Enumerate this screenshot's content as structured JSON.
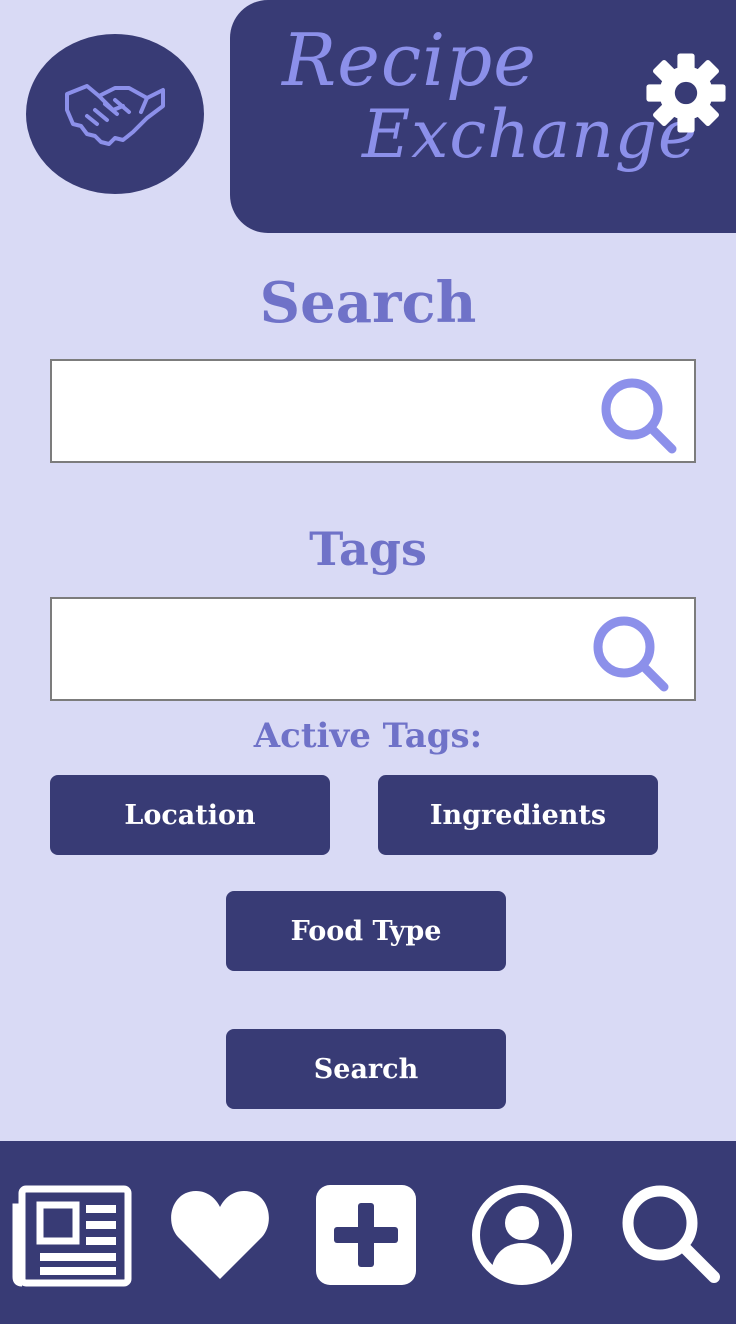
{
  "header": {
    "brand_line1": "Recipe",
    "brand_line2": "Exchange",
    "logo_icon": "handshake-icon",
    "settings_icon": "gear-icon"
  },
  "search": {
    "title": "Search",
    "placeholder": "",
    "value": "",
    "icon": "search-icon"
  },
  "tags": {
    "title": "Tags",
    "placeholder": "",
    "value": "",
    "icon": "search-icon",
    "active_title": "Active Tags:",
    "active": [
      "Location",
      "Ingredients",
      "Food Type"
    ]
  },
  "actions": {
    "search_label": "Search"
  },
  "bottom_nav": {
    "items": [
      {
        "icon": "newspaper-icon"
      },
      {
        "icon": "heart-icon"
      },
      {
        "icon": "add-icon"
      },
      {
        "icon": "profile-icon"
      },
      {
        "icon": "search-icon"
      }
    ]
  },
  "colors": {
    "background": "#d9daf5",
    "primary": "#383b75",
    "accent": "#8c90ea",
    "title": "#6f72c8"
  }
}
